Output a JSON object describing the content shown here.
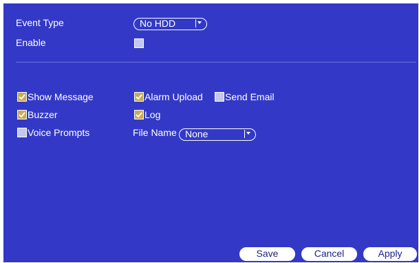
{
  "form": {
    "event_type_label": "Event Type",
    "event_type_value": "No HDD",
    "enable_label": "Enable",
    "enable_checked": false
  },
  "actions": {
    "show_message_label": "Show Message",
    "alarm_upload_label": "Alarm Upload",
    "send_email_label": "Send Email",
    "buzzer_label": "Buzzer",
    "log_label": "Log",
    "voice_prompts_label": "Voice Prompts",
    "file_name_label": "File Name",
    "file_name_value": "None"
  },
  "buttons": {
    "save": "Save",
    "cancel": "Cancel",
    "apply": "Apply"
  },
  "colors": {
    "panel_bg": "#3339c6",
    "checkbox_checked": "#c6ac5a",
    "checkbox_unchecked": "#c3c8ec"
  }
}
